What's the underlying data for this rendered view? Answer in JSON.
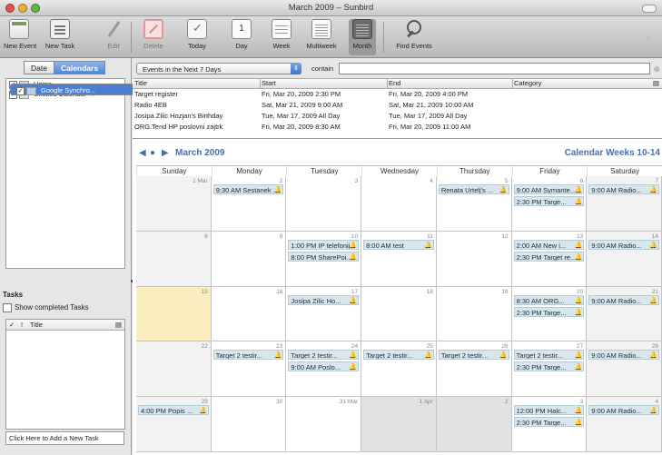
{
  "window": {
    "title": "March 2009 – Sunbird"
  },
  "toolbar": {
    "new_event": "New Event",
    "new_task": "New Task",
    "edit": "Edit",
    "delete": "Delete",
    "today": "Today",
    "day": "Day",
    "day_icon_text": "1",
    "week": "Week",
    "multiweek": "Multiweek",
    "month": "Month",
    "find_events": "Find Events"
  },
  "sidebar": {
    "tab_date": "Date",
    "tab_calendars": "Calendars",
    "calendars": [
      {
        "name": "Home",
        "checked": true,
        "color": "#c9d9f0",
        "warning": false,
        "selected": false
      },
      {
        "name": "Untitled Calendar",
        "checked": true,
        "color": "#d5e6cc",
        "warning": true,
        "selected": false
      },
      {
        "name": "Google Synchro...",
        "checked": true,
        "color": "#b9cde6",
        "warning": false,
        "selected": true
      }
    ],
    "tasks_heading": "Tasks",
    "show_completed": "Show completed Tasks",
    "task_col_title": "Title",
    "add_task_placeholder": "Click Here to Add a New Task"
  },
  "filter": {
    "selected": "Events in the Next 7 Days",
    "contain_label": "contain",
    "search_value": ""
  },
  "events_list": {
    "headers": [
      "Title",
      "Start",
      "End",
      "Category"
    ],
    "rows": [
      [
        "Target register",
        "Fri, Mar 20, 2009 2:30 PM",
        "Fri, Mar 20, 2009 4:00 PM",
        ""
      ],
      [
        "Radio 4EB",
        "Sat, Mar 21, 2009 9:00 AM",
        "Sat, Mar 21, 2009 10:00 AM",
        ""
      ],
      [
        "Josipa Zilic Hozjan's Birthday",
        "Tue, Mar 17, 2009 All Day",
        "Tue, Mar 17, 2009 All Day",
        ""
      ],
      [
        "ORG.Tend HP poslovni zajtrk",
        "Fri, Mar 20, 2009 8:30 AM",
        "Fri, Mar 20, 2009 11:00 AM",
        ""
      ]
    ]
  },
  "calendar": {
    "month_label": "March 2009",
    "weeks_label": "Calendar Weeks 10-14",
    "day_names": [
      "Sunday",
      "Monday",
      "Tuesday",
      "Wednesday",
      "Thursday",
      "Friday",
      "Saturday"
    ],
    "weeks": [
      [
        {
          "num": "1 Mar",
          "events": []
        },
        {
          "num": "2",
          "events": [
            "9:30 AM Sestanek ..."
          ]
        },
        {
          "num": "3",
          "events": []
        },
        {
          "num": "4",
          "events": []
        },
        {
          "num": "5",
          "events": [
            "Renata Urtelj's ..."
          ]
        },
        {
          "num": "6",
          "events": [
            "9:00 AM Symante...",
            "2:30 PM Targe..."
          ]
        },
        {
          "num": "7",
          "events": [
            "9:00 AM Radio..."
          ]
        }
      ],
      [
        {
          "num": "8",
          "events": []
        },
        {
          "num": "9",
          "events": []
        },
        {
          "num": "10",
          "events": [
            "1:00 PM IP telefonija",
            "8:00 PM SharePoi..."
          ]
        },
        {
          "num": "11",
          "events": [
            "8:00 AM test"
          ]
        },
        {
          "num": "12",
          "events": []
        },
        {
          "num": "13",
          "events": [
            "2:00 AM New i...",
            "2:30 PM Target re..."
          ]
        },
        {
          "num": "14",
          "events": [
            "9:00 AM Radio..."
          ]
        }
      ],
      [
        {
          "num": "15",
          "events": []
        },
        {
          "num": "16",
          "events": []
        },
        {
          "num": "17",
          "events": [
            "Josipa Zilic Ho..."
          ]
        },
        {
          "num": "18",
          "events": []
        },
        {
          "num": "19",
          "events": []
        },
        {
          "num": "20",
          "events": [
            "8:30 AM ORG...",
            "2:30 PM Targe..."
          ]
        },
        {
          "num": "21",
          "events": [
            "9:00 AM Radio..."
          ]
        }
      ],
      [
        {
          "num": "22",
          "events": []
        },
        {
          "num": "23",
          "events": [
            "Target 2 testir..."
          ]
        },
        {
          "num": "24",
          "events": [
            "Target 2 testir...",
            "9:00 AM Poslo..."
          ]
        },
        {
          "num": "25",
          "events": [
            "Target 2 testir..."
          ]
        },
        {
          "num": "26",
          "events": [
            "Target 2 testir..."
          ]
        },
        {
          "num": "27",
          "events": [
            "Target 2 testir...",
            "2:30 PM Targe..."
          ]
        },
        {
          "num": "28",
          "events": [
            "9:00 AM Radio..."
          ]
        }
      ],
      [
        {
          "num": "29",
          "events": [
            "4:00 PM Popis ..."
          ]
        },
        {
          "num": "30",
          "events": []
        },
        {
          "num": "31 Mar",
          "events": []
        },
        {
          "num": "1 Apr",
          "events": []
        },
        {
          "num": "2",
          "events": []
        },
        {
          "num": "3",
          "events": [
            "12:00 PM Halc...",
            "2:30 PM Targe..."
          ]
        },
        {
          "num": "4",
          "events": [
            "9:00 AM Radio..."
          ]
        }
      ]
    ],
    "today_cell": "15",
    "colors": {
      "event_bg": "#d8e6ee",
      "today_bg": "#faedc0",
      "weekend_bg": "#f2f2f2",
      "accent": "#4b6fa8"
    }
  }
}
